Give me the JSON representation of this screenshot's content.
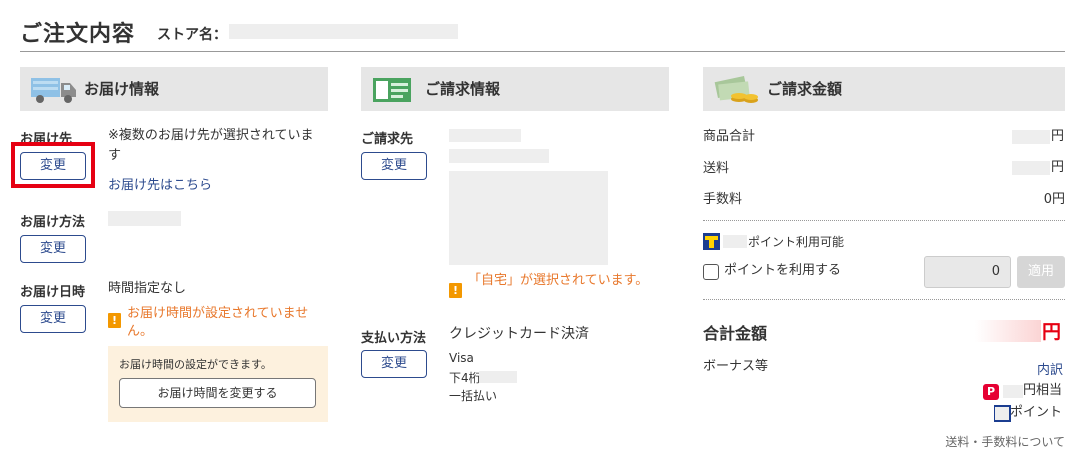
{
  "header": {
    "title": "ご注文内容",
    "store_label": "ストア名："
  },
  "delivery": {
    "section_title": "お届け情報",
    "icon": "truck-icon",
    "destination_label": "お届け先",
    "destination_note": "※複数のお届け先が選択されています",
    "destination_link": "お届け先はこちら",
    "change_label": "変更",
    "method_label": "お届け方法",
    "date_label": "お届け日時",
    "date_value": "時間指定なし",
    "time_warning": "お届け時間が設定されていません。",
    "time_box_note": "お届け時間の設定ができます。",
    "time_box_button": "お届け時間を変更する"
  },
  "billing": {
    "section_title": "ご請求情報",
    "icon": "id-card-icon",
    "billing_label": "ご請求先",
    "change_label": "変更",
    "home_warning": "「自宅」が選択されています。",
    "payment_label": "支払い方法",
    "payment_value": "クレジットカード決済",
    "card_brand": "Visa",
    "card_last4_label": "下4桁",
    "installment": "一括払い"
  },
  "amount": {
    "section_title": "ご請求金額",
    "icon": "money-icon",
    "subtotal_label": "商品合計",
    "subtotal_unit": "円",
    "shipping_label": "送料",
    "shipping_unit": "円",
    "fee_label": "手数料",
    "fee_value": "0円",
    "points_available": "ポイント利用可能",
    "use_points_label": "ポイントを利用する",
    "points_input_value": "0",
    "apply_label": "適用",
    "total_label": "合計金額",
    "total_unit": "円",
    "bonus_label": "ボーナス等",
    "breakdown_link": "内訳",
    "paypay_suffix": "円相当",
    "tpoint_suffix": "ポイント",
    "footer_link": "送料・手数料について"
  },
  "colors": {
    "accent_blue": "#2d4b8e",
    "warning_orange": "#e8782c",
    "total_red": "#e60012",
    "highlight_red": "#e60012"
  }
}
